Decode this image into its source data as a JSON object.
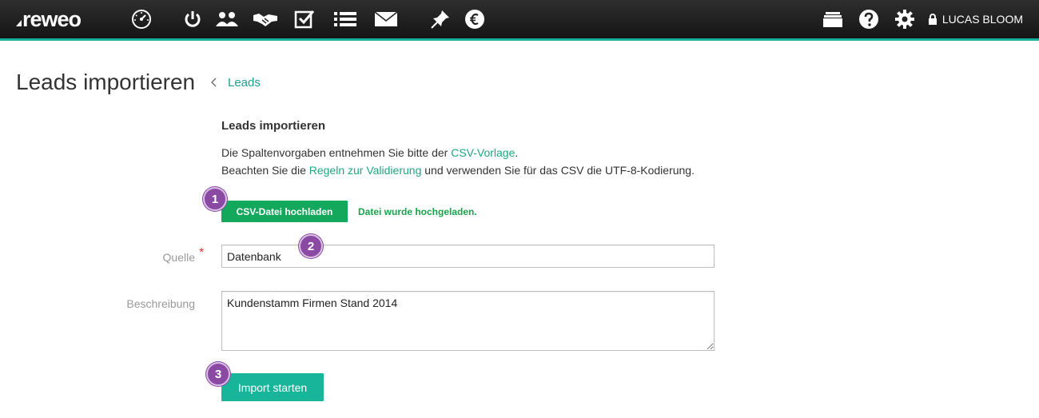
{
  "nav": {
    "logo": "reweo",
    "icons": [
      "dashboard-icon",
      "power-icon",
      "contacts-icon",
      "deals-icon",
      "tasks-icon",
      "list-icon",
      "mail-icon",
      "pin-icon",
      "euro-icon",
      "archive-icon",
      "help-icon",
      "gear-icon",
      "lock-icon"
    ],
    "user_name": "LUCAS BLOOM",
    "accent_color": "#1aae9f"
  },
  "header": {
    "title": "Leads importieren",
    "breadcrumb_link": "Leads"
  },
  "form": {
    "section_title": "Leads importieren",
    "info_line1_prefix": "Die Spaltenvorgaben entnehmen Sie bitte der ",
    "info_line1_link": "CSV-Vorlage",
    "info_line1_suffix": ".",
    "info_line2_prefix": "Beachten Sie die ",
    "info_line2_link": "Regeln zur Validierung",
    "info_line2_suffix": " und verwenden Sie für das CSV die UTF-8-Kodierung.",
    "upload_button": "CSV-Datei hochladen",
    "upload_status": "Datei wurde hochgeladen.",
    "source_label": "Quelle",
    "required_mark": "*",
    "source_value": "Datenbank",
    "description_label": "Beschreibung",
    "description_value": "Kundenstamm Firmen Stand 2014",
    "submit_button": "Import starten"
  },
  "steps": [
    "1",
    "2",
    "3"
  ]
}
